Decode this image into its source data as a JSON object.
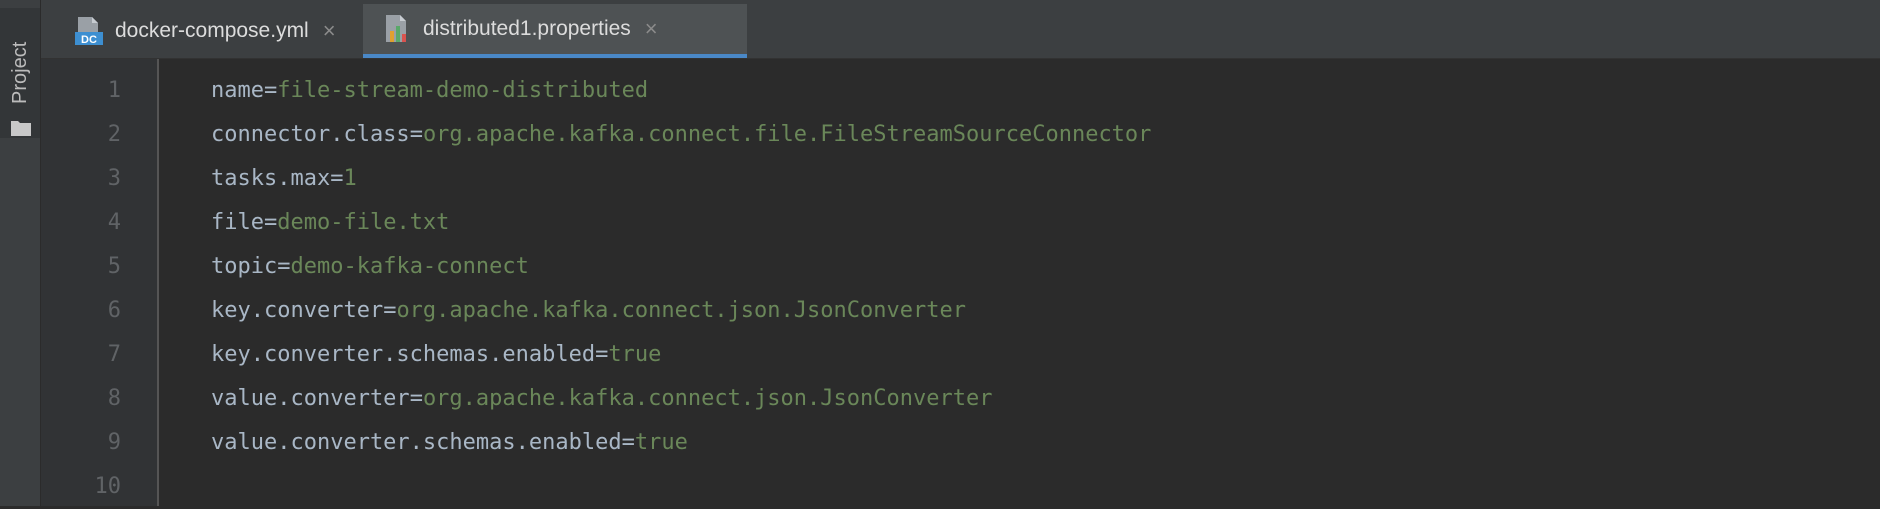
{
  "sidebar": {
    "project_label": "Project",
    "folder_icon": "folder-icon"
  },
  "tabs": [
    {
      "label": "docker-compose.yml",
      "icon": "docker-compose-icon",
      "badge": "DC",
      "close": "×",
      "active": false
    },
    {
      "label": "distributed1.properties",
      "icon": "properties-file-icon",
      "close": "×",
      "active": true
    }
  ],
  "editor": {
    "line_numbers": [
      "1",
      "2",
      "3",
      "4",
      "5",
      "6",
      "7",
      "8",
      "9",
      "10"
    ],
    "lines": [
      {
        "key": "name",
        "sep": "=",
        "value": "file-stream-demo-distributed"
      },
      {
        "key": "connector.class",
        "sep": "=",
        "value": "org.apache.kafka.connect.file.FileStreamSourceConnector"
      },
      {
        "key": "tasks.max",
        "sep": "=",
        "value": "1"
      },
      {
        "key": "file",
        "sep": "=",
        "value": "demo-file.txt"
      },
      {
        "key": "topic",
        "sep": "=",
        "value": "demo-kafka-connect"
      },
      {
        "key": "key.converter",
        "sep": "=",
        "value": "org.apache.kafka.connect.json.JsonConverter"
      },
      {
        "key": "key.converter.schemas.enabled",
        "sep": "=",
        "value": "true"
      },
      {
        "key": "value.converter",
        "sep": "=",
        "value": "org.apache.kafka.connect.json.JsonConverter"
      },
      {
        "key": "value.converter.schemas.enabled",
        "sep": "=",
        "value": "true"
      },
      {
        "key": "",
        "sep": "",
        "value": ""
      }
    ]
  },
  "colors": {
    "background": "#2b2b2b",
    "key_text": "#a9b7c6",
    "value_text": "#6a8759",
    "line_number": "#606366",
    "active_tab_underline": "#4a88c7"
  }
}
